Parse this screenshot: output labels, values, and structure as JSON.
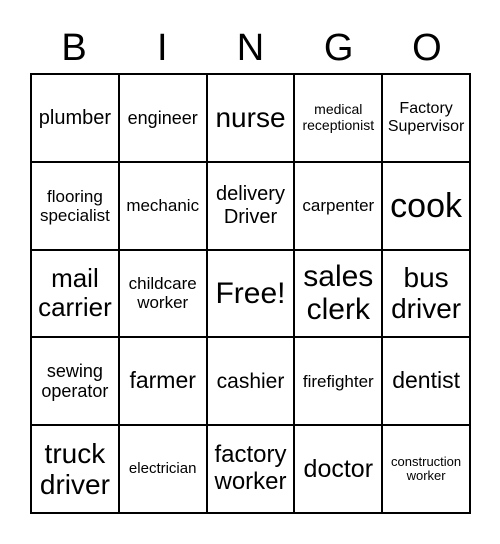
{
  "header": [
    "B",
    "I",
    "N",
    "G",
    "O"
  ],
  "cells": [
    [
      "plumber",
      "engineer",
      "nurse",
      "medical receptionist",
      "Factory Supervisor"
    ],
    [
      "flooring specialist",
      "mechanic",
      "delivery Driver",
      "carpenter",
      "cook"
    ],
    [
      "mail carrier",
      "childcare worker",
      "Free!",
      "sales clerk",
      "bus driver"
    ],
    [
      "sewing operator",
      "farmer",
      "cashier",
      "firefighter",
      "dentist"
    ],
    [
      "truck driver",
      "electrician",
      "factory worker",
      "doctor",
      "construction worker"
    ]
  ]
}
